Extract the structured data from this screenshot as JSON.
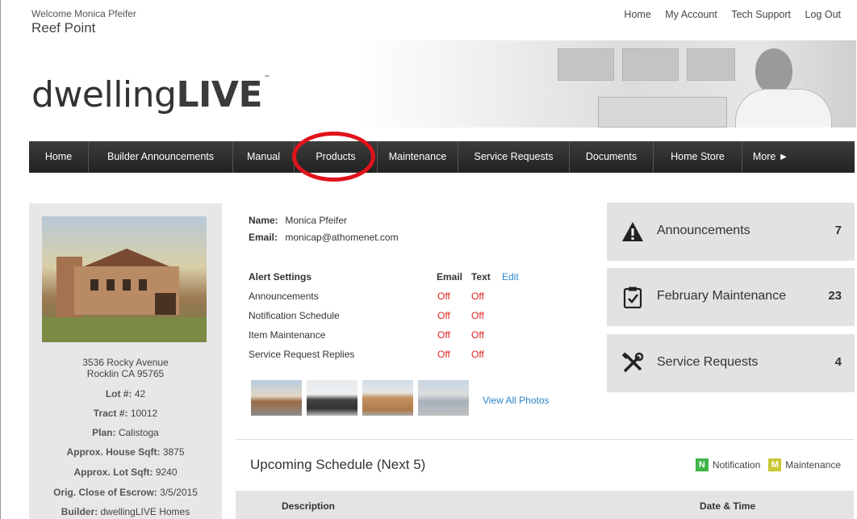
{
  "header": {
    "welcome": "Welcome Monica Pfeifer",
    "community": "Reef Point",
    "top_links": [
      "Home",
      "My Account",
      "Tech Support",
      "Log Out"
    ],
    "logo_light": "dwelling",
    "logo_bold": "LIVE",
    "logo_tm": "™"
  },
  "nav": {
    "items": [
      "Home",
      "Builder Announcements",
      "Manual",
      "Products",
      "Maintenance",
      "Service Requests",
      "Documents",
      "Home Store",
      "More ►"
    ],
    "highlight_color": "#e0121a"
  },
  "property": {
    "address1": "3536 Rocky Avenue",
    "address2": "Rocklin CA 95765",
    "lot_label": "Lot #:",
    "lot": "42",
    "tract_label": "Tract #:",
    "tract": "10012",
    "plan_label": "Plan:",
    "plan": "Calistoga",
    "house_sqft_label": "Approx. House Sqft:",
    "house_sqft": "3875",
    "lot_sqft_label": "Approx. Lot Sqft:",
    "lot_sqft": "9240",
    "coe_label": "Orig. Close of Escrow:",
    "coe": "3/5/2015",
    "builder_label": "Builder:",
    "builder": "dwellingLIVE Homes"
  },
  "profile": {
    "name_label": "Name:",
    "name": "Monica Pfeifer",
    "email_label": "Email:",
    "email": "monicap@athomenet.com"
  },
  "alerts": {
    "title": "Alert Settings",
    "col_email": "Email",
    "col_text": "Text",
    "edit": "Edit",
    "rows": [
      {
        "label": "Announcements",
        "email": "Off",
        "text": "Off"
      },
      {
        "label": "Notification Schedule",
        "email": "Off",
        "text": "Off"
      },
      {
        "label": "Item Maintenance",
        "email": "Off",
        "text": "Off"
      },
      {
        "label": "Service Request Replies",
        "email": "Off",
        "text": "Off"
      }
    ]
  },
  "photos": {
    "view_all": "View All Photos"
  },
  "schedule": {
    "title": "Upcoming Schedule (Next 5)",
    "legend_n_badge": "N",
    "legend_n": "Notification",
    "legend_n_color": "#3fb449",
    "legend_m_badge": "M",
    "legend_m": "Maintenance",
    "legend_m_color": "#c8c834",
    "col_description": "Description",
    "col_datetime": "Date & Time"
  },
  "cards": [
    {
      "label": "Announcements",
      "count": "7",
      "icon": "warning-icon"
    },
    {
      "label": "February Maintenance",
      "count": "23",
      "icon": "clipboard-check-icon"
    },
    {
      "label": "Service Requests",
      "count": "4",
      "icon": "tools-icon"
    }
  ]
}
